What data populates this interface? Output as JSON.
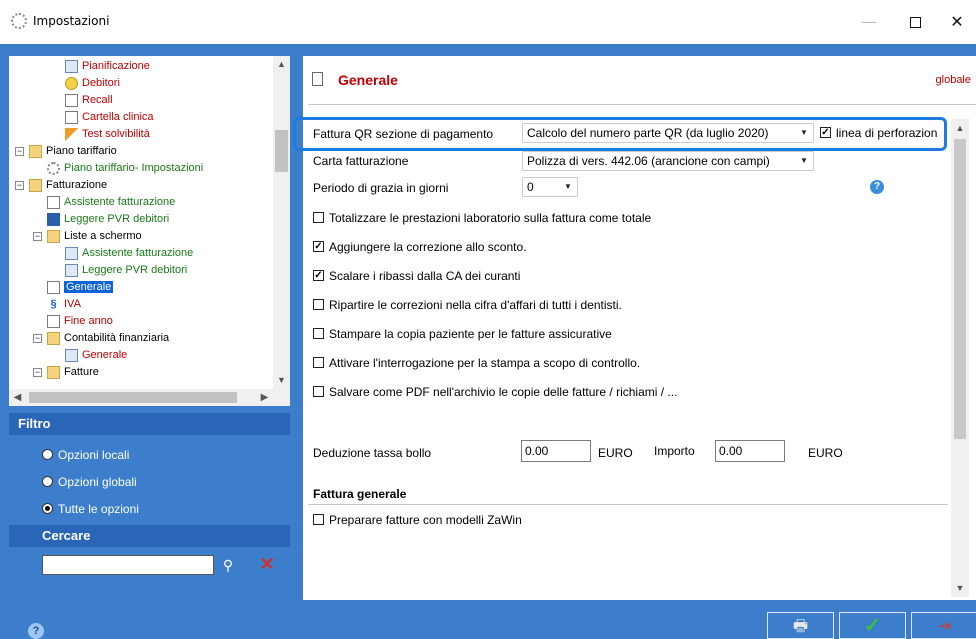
{
  "window": {
    "title": "Impostazioni",
    "min": "—",
    "close": "✕"
  },
  "tree": {
    "items": [
      {
        "label": "Pianificazione",
        "color": "red",
        "icon": "calendar-icon"
      },
      {
        "label": "Debitori",
        "color": "red",
        "icon": "debtor-badge-icon"
      },
      {
        "label": "Recall",
        "color": "red",
        "icon": "recall-doc-icon"
      },
      {
        "label": "Cartella clinica",
        "color": "red",
        "icon": "document-icon"
      },
      {
        "label": "Test solvibilità",
        "color": "red",
        "icon": "pen-icon"
      },
      {
        "label": "Piano tariffario",
        "color": "black",
        "icon": "folder-icon"
      },
      {
        "label": "Piano tariffario- Impostazioni",
        "color": "green",
        "icon": "gear-icon"
      },
      {
        "label": "Fatturazione",
        "color": "black",
        "icon": "folder-icon"
      },
      {
        "label": "Assistente fatturazione",
        "color": "green",
        "icon": "document-icon"
      },
      {
        "label": "Leggere PVR debitori",
        "color": "green",
        "icon": "bank-icon"
      },
      {
        "label": "Liste a schermo",
        "color": "black",
        "icon": "folder-icon"
      },
      {
        "label": "Assistente fatturazione",
        "color": "green",
        "icon": "table-icon"
      },
      {
        "label": "Leggere PVR debitori",
        "color": "green",
        "icon": "table-icon"
      },
      {
        "label": "Generale",
        "color": "selected",
        "icon": "document-icon"
      },
      {
        "label": "IVA",
        "color": "red",
        "icon": "paragraph-icon"
      },
      {
        "label": "Fine anno",
        "color": "red",
        "icon": "printer-icon"
      },
      {
        "label": "Contabilità finanziaria",
        "color": "black",
        "icon": "folder-icon"
      },
      {
        "label": "Generale",
        "color": "red",
        "icon": "chart-icon"
      },
      {
        "label": "Fatture",
        "color": "black",
        "icon": "folder-icon"
      }
    ]
  },
  "filter": {
    "title": "Filtro",
    "options": [
      "Opzioni locali",
      "Opzioni globali",
      "Tutte le opzioni"
    ],
    "selected_index": 2
  },
  "search": {
    "title": "Cercare",
    "value": "",
    "placeholder": ""
  },
  "content": {
    "title": "Generale",
    "scope": "globale",
    "qr_label": "Fattura QR sezione di pagamento",
    "qr_value": "Calcolo del numero parte QR (da luglio 2020)",
    "perforation_label": "linea di perforazion",
    "perforation_checked": true,
    "carta_label": "Carta fatturazione",
    "carta_value": "Polizza di vers. 442.06 (arancione con campi)",
    "grazia_label": "Periodo di grazia in giorni",
    "grazia_value": "0",
    "checkboxes": [
      {
        "label": "Totalizzare le prestazioni laboratorio sulla fattura come totale",
        "checked": false
      },
      {
        "label": "Aggiungere la correzione allo sconto.",
        "checked": true
      },
      {
        "label": "Scalare i ribassi dalla CA dei curanti",
        "checked": true
      },
      {
        "label": "Ripartire le correzioni nella cifra d'affari di tutti i dentisti.",
        "checked": false
      },
      {
        "label": "Stampare la copia paziente per le fatture assicurative",
        "checked": false
      },
      {
        "label": "Attivare l'interrogazione per la stampa a scopo di controllo.",
        "checked": false
      },
      {
        "label": "Salvare come PDF nell'archivio le copie delle fatture / richiami / ...",
        "checked": false
      }
    ],
    "bollo_label": "Deduzione tassa bollo",
    "bollo_value": "0.00",
    "euro1": "EURO",
    "importo_label": "Importo",
    "importo_value": "0.00",
    "euro2": "EURO",
    "section_title": "Fattura generale",
    "zawin_label": "Preparare fatture con modelli ZaWin",
    "zawin_checked": false
  },
  "footer": {
    "help": "?",
    "print": "print-icon",
    "ok": "✓",
    "exit": "exit-icon"
  }
}
